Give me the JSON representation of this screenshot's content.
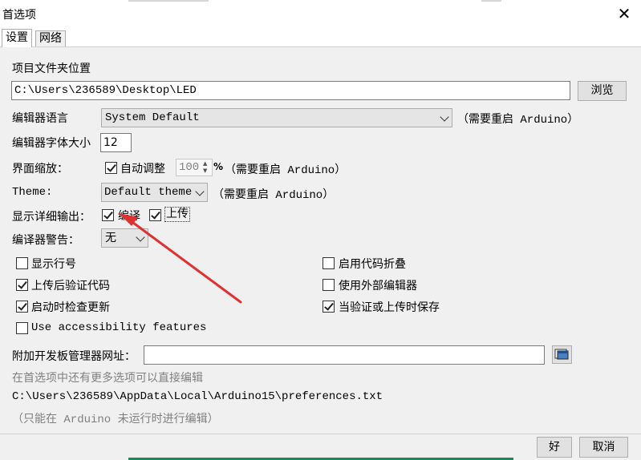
{
  "window": {
    "title": "首选项",
    "close_glyph": "✕"
  },
  "tabs": [
    {
      "label": "设置"
    },
    {
      "label": "网络"
    }
  ],
  "sketchbook": {
    "label": "项目文件夹位置",
    "path": "C:\\Users\\236589\\Desktop\\LED",
    "browse_label": "浏览"
  },
  "editor_language": {
    "label": "编辑器语言",
    "value": "System Default",
    "note": "（需要重启 Arduino）"
  },
  "editor_font_size": {
    "label": "编辑器字体大小",
    "value": "12"
  },
  "interface_scale": {
    "label": "界面缩放：",
    "auto_label": "自动调整",
    "auto_checked": true,
    "value": "100",
    "unit": "%",
    "note": "（需要重启 Arduino）"
  },
  "theme": {
    "label": "Theme:",
    "value": "Default theme",
    "note": "（需要重启 Arduino）"
  },
  "verbose_output": {
    "label": "显示详细输出：",
    "compile_label": "编译",
    "compile_checked": true,
    "upload_label": "上传",
    "upload_checked": true
  },
  "compiler_warnings": {
    "label": "编译器警告：",
    "value": "无"
  },
  "options_left": [
    {
      "label": "显示行号",
      "checked": false
    },
    {
      "label": "上传后验证代码",
      "checked": true
    },
    {
      "label": "启动时检查更新",
      "checked": true
    },
    {
      "label": "Use accessibility features",
      "checked": false
    }
  ],
  "options_right": [
    {
      "label": "启用代码折叠",
      "checked": false
    },
    {
      "label": "使用外部编辑器",
      "checked": false
    },
    {
      "label": "当验证或上传时保存",
      "checked": true
    }
  ],
  "board_manager": {
    "label": "附加开发板管理器网址：",
    "value": "",
    "button_icon": "window-list-icon"
  },
  "more_prefs_note": "在首选项中还有更多选项可以直接编辑",
  "prefs_path": "C:\\Users\\236589\\AppData\\Local\\Arduino15\\preferences.txt",
  "edit_note": "（只能在 Arduino 未运行时进行编辑）",
  "buttons": {
    "ok_label": "好",
    "cancel_label": "取消"
  },
  "colors": {
    "panel_bg": "#f0f0f0",
    "annotation_arrow": "#e03131"
  }
}
